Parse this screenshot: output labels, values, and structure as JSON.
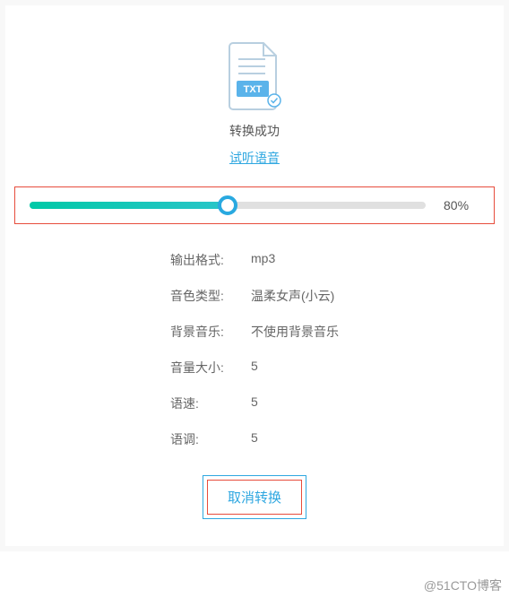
{
  "icon": {
    "badge_text": "TXT"
  },
  "status_text": "转换成功",
  "preview_link_text": "试听语音",
  "slider": {
    "percent_label": "80%",
    "fill_percent": 50
  },
  "settings": {
    "output_format": {
      "label": "输出格式:",
      "value": "mp3"
    },
    "voice_type": {
      "label": "音色类型:",
      "value": "温柔女声(小云)"
    },
    "bg_music": {
      "label": "背景音乐:",
      "value": "不使用背景音乐"
    },
    "volume": {
      "label": "音量大小:",
      "value": "5"
    },
    "speed": {
      "label": "语速:",
      "value": "5"
    },
    "tone": {
      "label": "语调:",
      "value": "5"
    }
  },
  "cancel_button_label": "取消转换",
  "watermark": "@51CTO博客"
}
